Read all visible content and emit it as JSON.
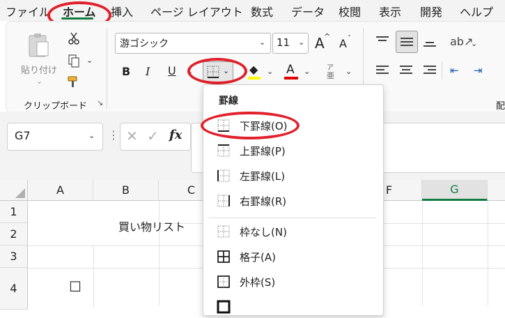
{
  "menubar": {
    "tabs": [
      "ファイル",
      "ホーム",
      "挿入",
      "ページ レイアウト",
      "数式",
      "データ",
      "校閲",
      "表示",
      "開発",
      "ヘルプ"
    ],
    "active_tab": "ホーム"
  },
  "ribbon": {
    "paste_label": "貼り付け",
    "clipboard_label": "クリップボード",
    "font_name": "游ゴシック",
    "font_size": "11",
    "grow_font": "A",
    "shrink_font": "A",
    "bold": "B",
    "italic": "I",
    "underline": "U",
    "font_color_glyph": "A",
    "phonetic_glyph": "ア",
    "phonetic_sub": "亜",
    "group_label_clip": "配"
  },
  "formula_bar": {
    "name_box": "G7",
    "fx": "fx",
    "cancel": "✕",
    "enter": "✓"
  },
  "grid": {
    "columns": [
      "A",
      "B",
      "C",
      "",
      "F",
      "G"
    ],
    "rows": [
      "1",
      "2",
      "3",
      "4"
    ],
    "title_cell": "買い物リスト",
    "checkbox_glyph": "☐"
  },
  "border_menu": {
    "title": "罫線",
    "items": [
      {
        "label": "下罫線(O)"
      },
      {
        "label": "上罫線(P)"
      },
      {
        "label": "左罫線(L)"
      },
      {
        "label": "右罫線(R)"
      },
      {
        "label": "枠なし(N)"
      },
      {
        "label": "格子(A)"
      },
      {
        "label": "外枠(S)"
      }
    ]
  },
  "colors": {
    "accent_green": "#107c41",
    "annotation_red": "#e0202a",
    "highlight_yellow": "#ffff00",
    "font_red": "#e00000"
  }
}
